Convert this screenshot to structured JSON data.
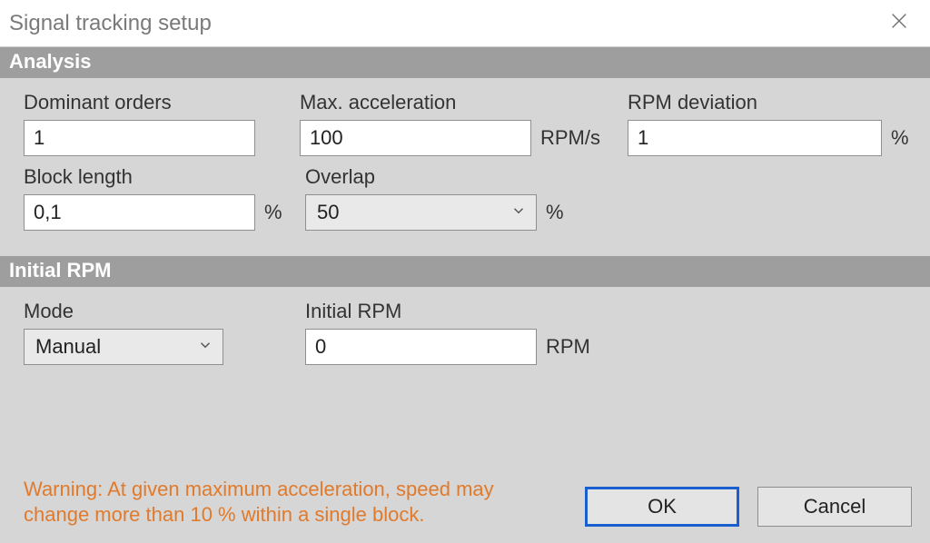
{
  "window": {
    "title": "Signal tracking setup"
  },
  "sections": {
    "analysis": {
      "header": "Analysis",
      "dominant_orders": {
        "label": "Dominant orders",
        "value": "1"
      },
      "max_acceleration": {
        "label": "Max. acceleration",
        "value": "100",
        "unit": "RPM/s"
      },
      "rpm_deviation": {
        "label": "RPM deviation",
        "value": "1",
        "unit": "%"
      },
      "block_length": {
        "label": "Block length",
        "value": "0,1",
        "unit": "%"
      },
      "overlap": {
        "label": "Overlap",
        "value": "50",
        "unit": "%"
      }
    },
    "initial_rpm": {
      "header": "Initial RPM",
      "mode": {
        "label": "Mode",
        "value": "Manual"
      },
      "initial_rpm": {
        "label": "Initial RPM",
        "value": "0",
        "unit": "RPM"
      }
    }
  },
  "footer": {
    "warning": "Warning: At given maximum acceleration, speed may change more than 10 % within a single block.",
    "ok": "OK",
    "cancel": "Cancel"
  }
}
